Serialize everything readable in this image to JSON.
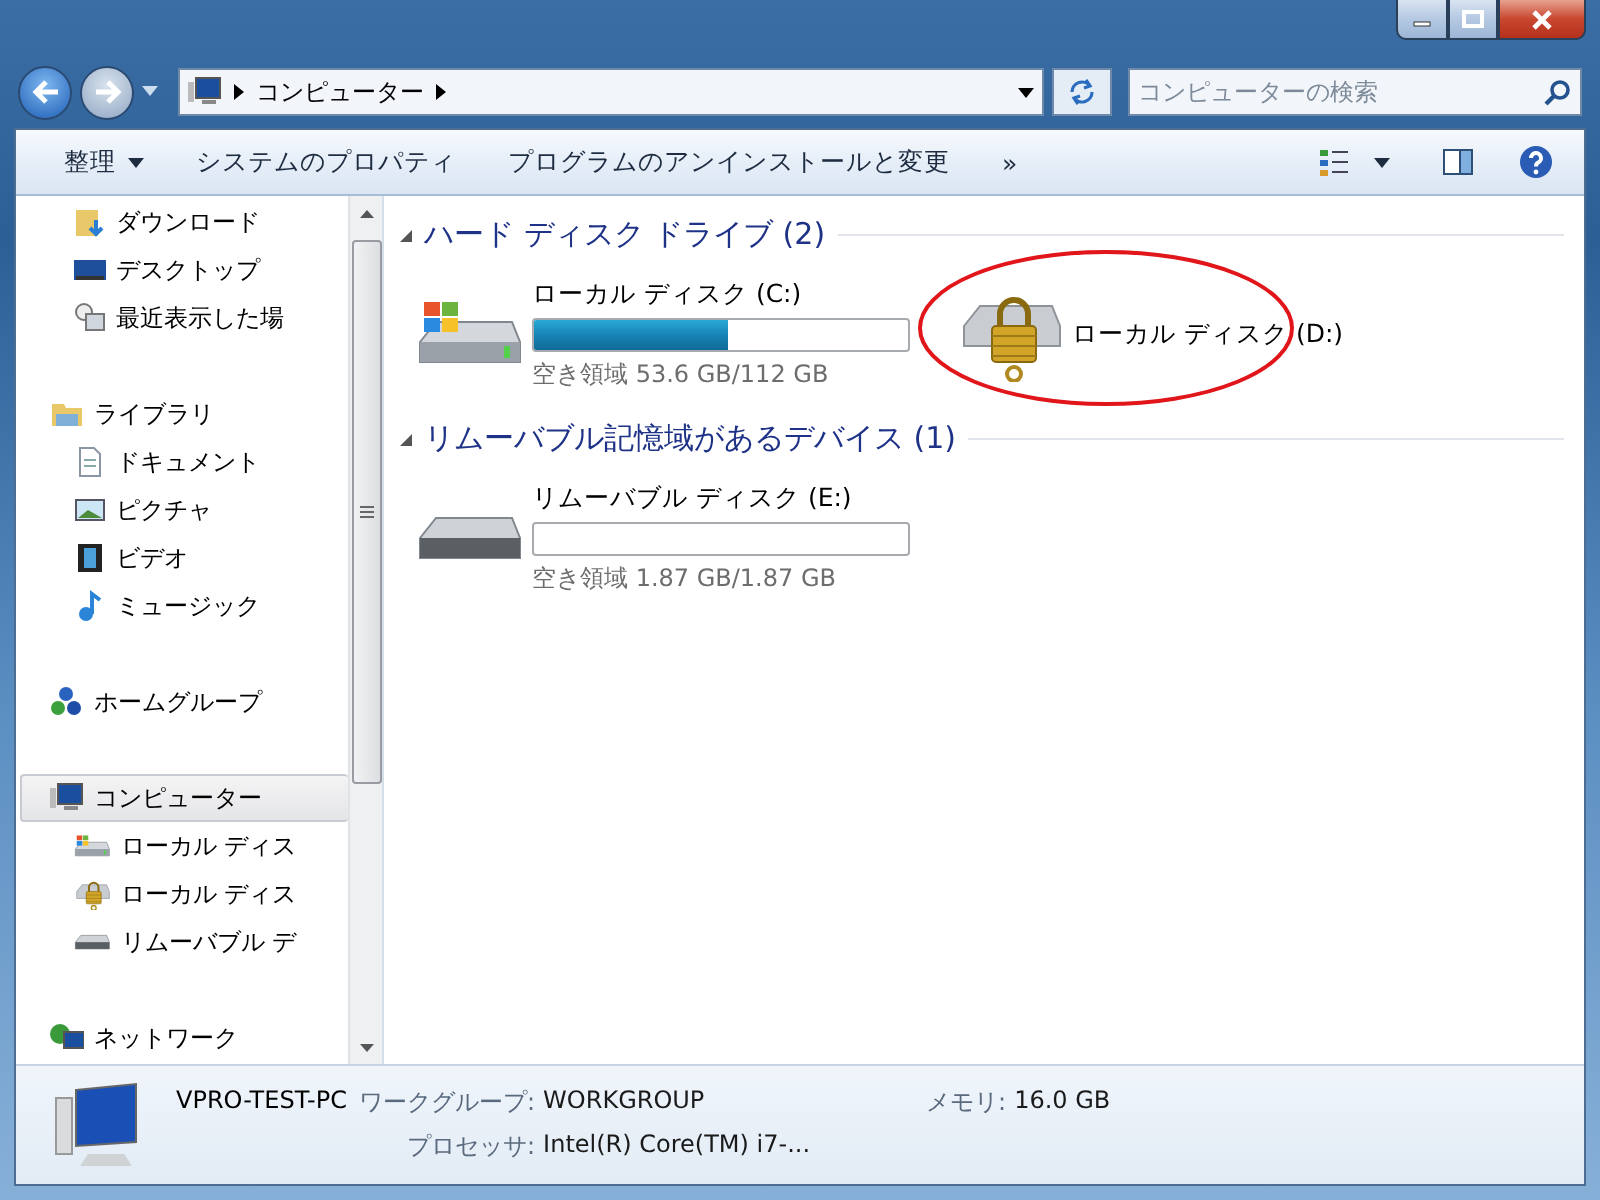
{
  "address_bar": {
    "path": [
      "コンピューター"
    ]
  },
  "search": {
    "placeholder": "コンピューターの検索"
  },
  "toolbar": [
    {
      "kind": "menu",
      "label": "整理"
    },
    {
      "kind": "button",
      "label": "システムのプロパティ"
    },
    {
      "kind": "button",
      "label": "プログラムのアンインストールと変更"
    },
    {
      "kind": "button",
      "label": "»"
    }
  ],
  "nav": [
    {
      "children": [
        {
          "kind": "download",
          "label": "ダウンロード",
          "selected": false
        },
        {
          "kind": "desktop",
          "label": "デスクトップ",
          "selected": false
        },
        {
          "kind": "recent",
          "label": "最近表示した場",
          "selected": false
        }
      ]
    },
    {
      "kind": "library",
      "label": "ライブラリ",
      "selected": false,
      "children": [
        {
          "kind": "document",
          "label": "ドキュメント",
          "selected": false
        },
        {
          "kind": "picture",
          "label": "ピクチャ",
          "selected": false
        },
        {
          "kind": "video",
          "label": "ビデオ",
          "selected": false
        },
        {
          "kind": "music",
          "label": "ミュージック",
          "selected": false
        }
      ]
    },
    {
      "kind": "homegroup",
      "label": "ホームグループ",
      "selected": false
    },
    {
      "kind": "computer",
      "label": "コンピューター",
      "selected": true,
      "children": [
        {
          "kind": "windows-disk",
          "label": "ローカル ディス",
          "selected": false
        },
        {
          "kind": "locked-disk",
          "label": "ローカル ディス",
          "selected": false
        },
        {
          "kind": "removable",
          "label": "リムーバブル デ",
          "selected": false
        }
      ]
    },
    {
      "kind": "network",
      "label": "ネットワーク",
      "selected": false
    }
  ],
  "groups": [
    {
      "title": "ハード ディスク ドライブ (2)",
      "expanded": true,
      "drives": [
        {
          "kind": "windows-disk",
          "name": "ローカル ディスク (C:)",
          "level": 0.52,
          "free": "空き領域 53.6 GB/112 GB",
          "circled": false
        },
        {
          "kind": "locked-disk",
          "name": "ローカル ディスク (D:)",
          "circled": true
        }
      ]
    },
    {
      "title": "リムーバブル記憶域があるデバイス (1)",
      "expanded": true,
      "drives": [
        {
          "kind": "removable",
          "name": "リムーバブル ディスク (E:)",
          "level": 0,
          "free": "空き領域 1.87 GB/1.87 GB",
          "circled": false
        }
      ]
    }
  ],
  "details": {
    "name": "VPRO-TEST-PC",
    "fields": [
      {
        "label": "ワークグループ:",
        "value": "WORKGROUP"
      },
      {
        "label": "メモリ:",
        "value": "16.0 GB"
      },
      {
        "label": "プロセッサ:",
        "value": "Intel(R) Core(TM) i7-..."
      }
    ]
  }
}
